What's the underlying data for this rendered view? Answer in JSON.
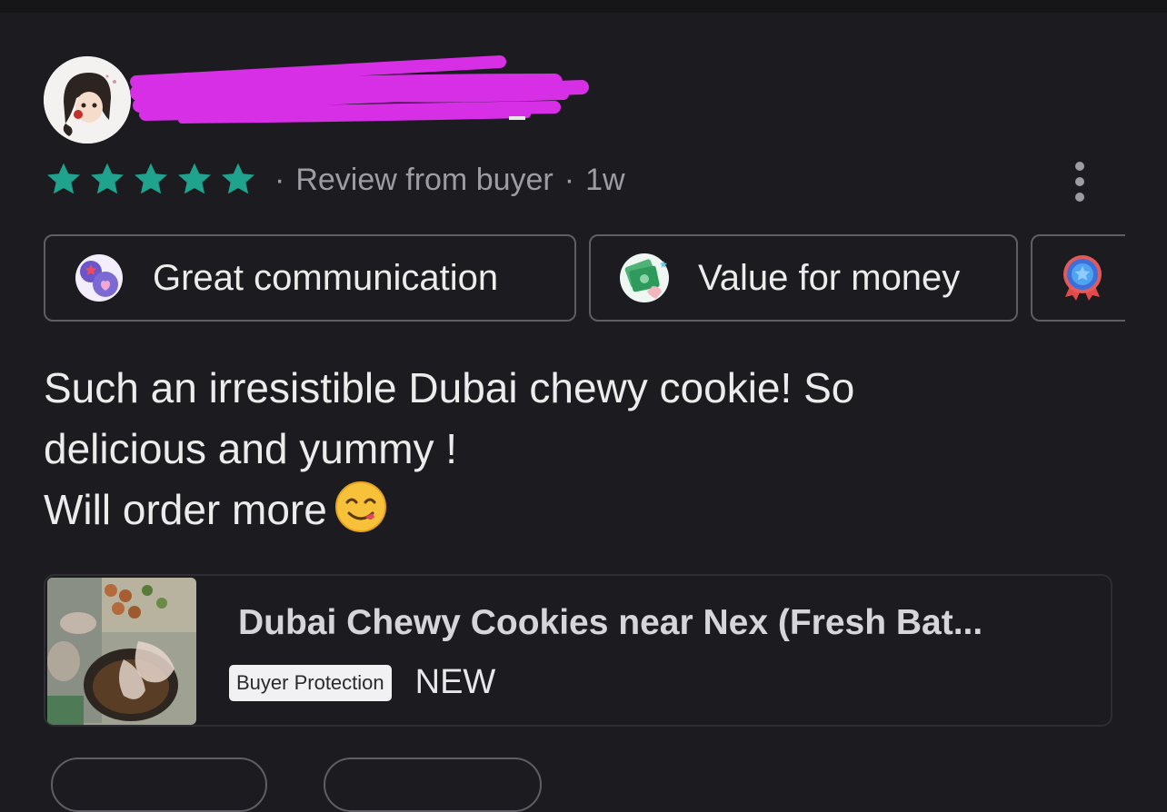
{
  "review": {
    "rating": 5,
    "meta": {
      "separator": "·",
      "label": "Review from buyer",
      "time": "1w"
    },
    "tags": [
      {
        "label": "Great communication",
        "icon": "chat-heart-icon"
      },
      {
        "label": "Value for money",
        "icon": "money-hand-icon"
      },
      {
        "label": "",
        "icon": "award-ribbon-icon"
      }
    ],
    "text_lines": [
      "Such an irresistible Dubai chewy cookie! So",
      "delicious and yummy !",
      "Will order more"
    ],
    "emoji": "yum-face-emoji"
  },
  "product": {
    "title": "Dubai Chewy Cookies near Nex (Fresh Bat...",
    "badge": "Buyer Protection",
    "condition": "NEW"
  },
  "colors": {
    "background": "#1c1b1f",
    "star": "#1fa38e",
    "muted": "#9c9ca2",
    "redaction": "#d62fe6"
  }
}
